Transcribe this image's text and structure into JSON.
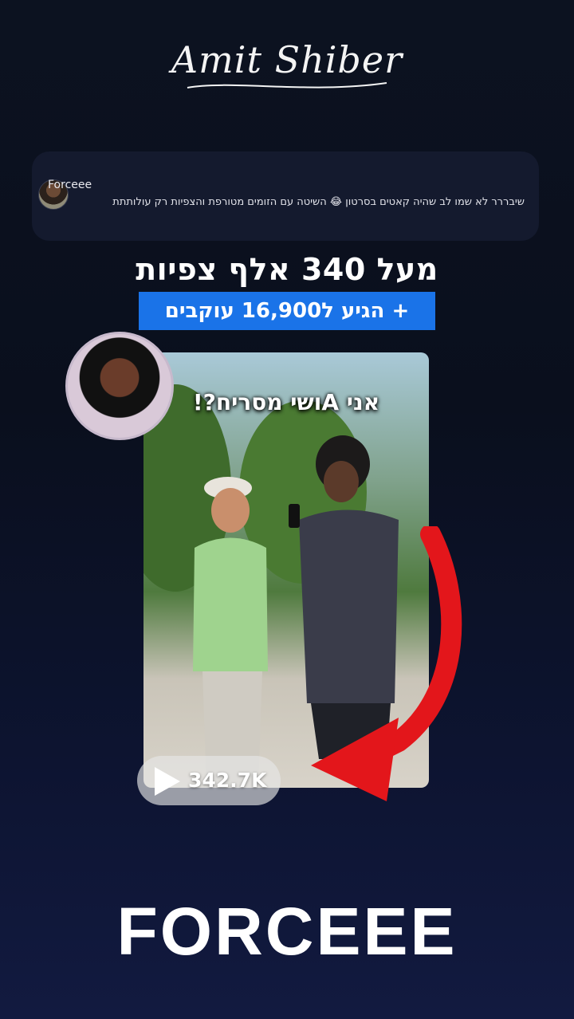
{
  "logo": {
    "text": "Amit Shiber"
  },
  "comment": {
    "username": "Forceee",
    "text": "שיבררר לא שמו לב שהיה קאטים בסרטון 😂 השיטה עם הזומים מטורפת והצפיות רק עולותתת"
  },
  "headline": "מעל 340 אלף צפיות",
  "highlight": "+ הגיע ל16,900 עוקבים",
  "video": {
    "caption": "אני Aושי מסריח?!",
    "views": "342.7K"
  },
  "brand": "FORCEEE",
  "colors": {
    "accent_blue": "#1a73e8",
    "arrow_red": "#e3161b",
    "card_bg": "#141a2e"
  },
  "icons": {
    "play": "play-icon",
    "arrow": "red-curved-arrow-icon"
  }
}
